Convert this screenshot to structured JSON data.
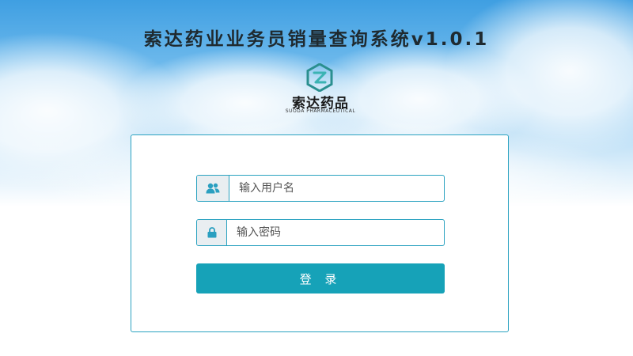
{
  "app": {
    "title": "索达药业业务员销量查询系统v1.0.1"
  },
  "logo": {
    "name": "索达药品",
    "subtitle": "SUODA PHARMACEUTICAL"
  },
  "login": {
    "username_placeholder": "输入用户名",
    "password_placeholder": "输入密码",
    "submit_label": "登 录"
  },
  "icons": {
    "username": "users-icon",
    "password": "lock-icon"
  },
  "colors": {
    "accent": "#16a2b8",
    "border": "#2aa2c0",
    "icon_bg": "#e9eef1",
    "sky_top": "#3f9fe2"
  }
}
